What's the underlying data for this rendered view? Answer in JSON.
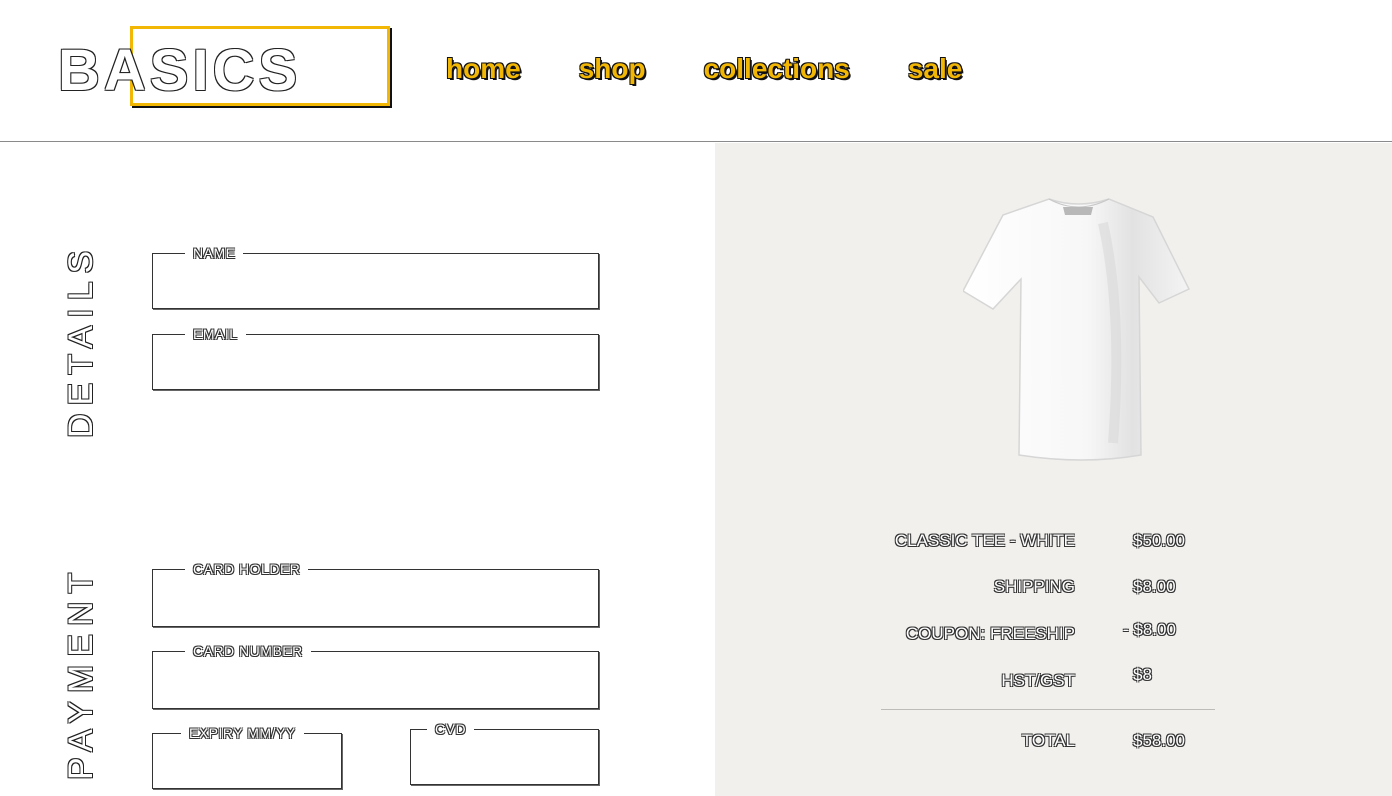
{
  "header": {
    "logo": "BASICS",
    "nav": [
      {
        "label": "home"
      },
      {
        "label": "shop"
      },
      {
        "label": "collections"
      },
      {
        "label": "sale"
      }
    ]
  },
  "details": {
    "section_title": "DETAILS",
    "name_label": "NAME",
    "name_value": "",
    "email_label": "EMAIL",
    "email_value": ""
  },
  "payment": {
    "section_title": "PAYMENT",
    "card_holder_label": "CARD HOLDER",
    "card_holder_value": "",
    "card_number_label": "CARD NUMBER",
    "card_number_value": "",
    "expiry_label": "EXPIRY MM/YY",
    "expiry_value": "",
    "cvd_label": "CVD",
    "cvd_value": ""
  },
  "summary": {
    "product_image_icon": "white-tshirt-image",
    "rows": [
      {
        "label": "CLASSIC TEE - WHITE",
        "value": "$50.00"
      },
      {
        "label": "SHIPPING",
        "value": "$8.00"
      },
      {
        "label": "COUPON: FREESHIP",
        "value": "- $8.00"
      },
      {
        "label": "HST/GST",
        "value": "$8"
      }
    ],
    "total_label": "TOTAL",
    "total_value": "$58.00"
  },
  "colors": {
    "accent": "#f2b705",
    "panel_bg": "#f1f0ed"
  }
}
